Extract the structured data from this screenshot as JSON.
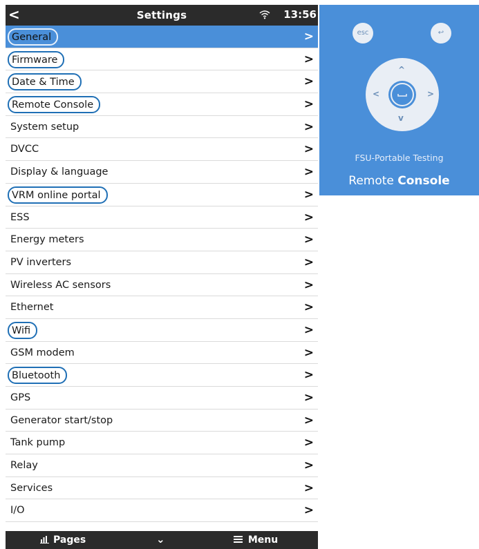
{
  "statusbar": {
    "back_glyph": "<",
    "title": "Settings",
    "time": "13:56",
    "wifi_icon": "wifi-icon"
  },
  "menu": {
    "chevron_glyph": ">",
    "selected_index": 0,
    "items": [
      {
        "label": "General",
        "circled": true
      },
      {
        "label": "Firmware",
        "circled": true
      },
      {
        "label": "Date & Time",
        "circled": true
      },
      {
        "label": "Remote Console",
        "circled": true
      },
      {
        "label": "System setup",
        "circled": false
      },
      {
        "label": "DVCC",
        "circled": false
      },
      {
        "label": "Display & language",
        "circled": false
      },
      {
        "label": "VRM online portal",
        "circled": true
      },
      {
        "label": "ESS",
        "circled": false
      },
      {
        "label": "Energy meters",
        "circled": false
      },
      {
        "label": "PV inverters",
        "circled": false
      },
      {
        "label": "Wireless AC sensors",
        "circled": false
      },
      {
        "label": "Ethernet",
        "circled": false
      },
      {
        "label": "Wifi",
        "circled": true
      },
      {
        "label": "GSM modem",
        "circled": false
      },
      {
        "label": "Bluetooth",
        "circled": true
      },
      {
        "label": "GPS",
        "circled": false
      },
      {
        "label": "Generator start/stop",
        "circled": false
      },
      {
        "label": "Tank pump",
        "circled": false
      },
      {
        "label": "Relay",
        "circled": false
      },
      {
        "label": "Services",
        "circled": false
      },
      {
        "label": "I/O",
        "circled": false
      }
    ]
  },
  "bottombar": {
    "pages_label": "Pages",
    "collapse_glyph": "⌄",
    "menu_label": "Menu"
  },
  "remote_console": {
    "esc_label": "esc",
    "enter_glyph": "↩",
    "up_glyph": "^",
    "down_glyph": "v",
    "left_glyph": "<",
    "right_glyph": ">",
    "device_name": "FSU-Portable Testing",
    "title_prefix": "Remote ",
    "title_strong": "Console"
  },
  "colors": {
    "accent_blue": "#4a8fd9",
    "bar_dark": "#2b2b2b",
    "circle_outline": "#1f6fb5"
  }
}
